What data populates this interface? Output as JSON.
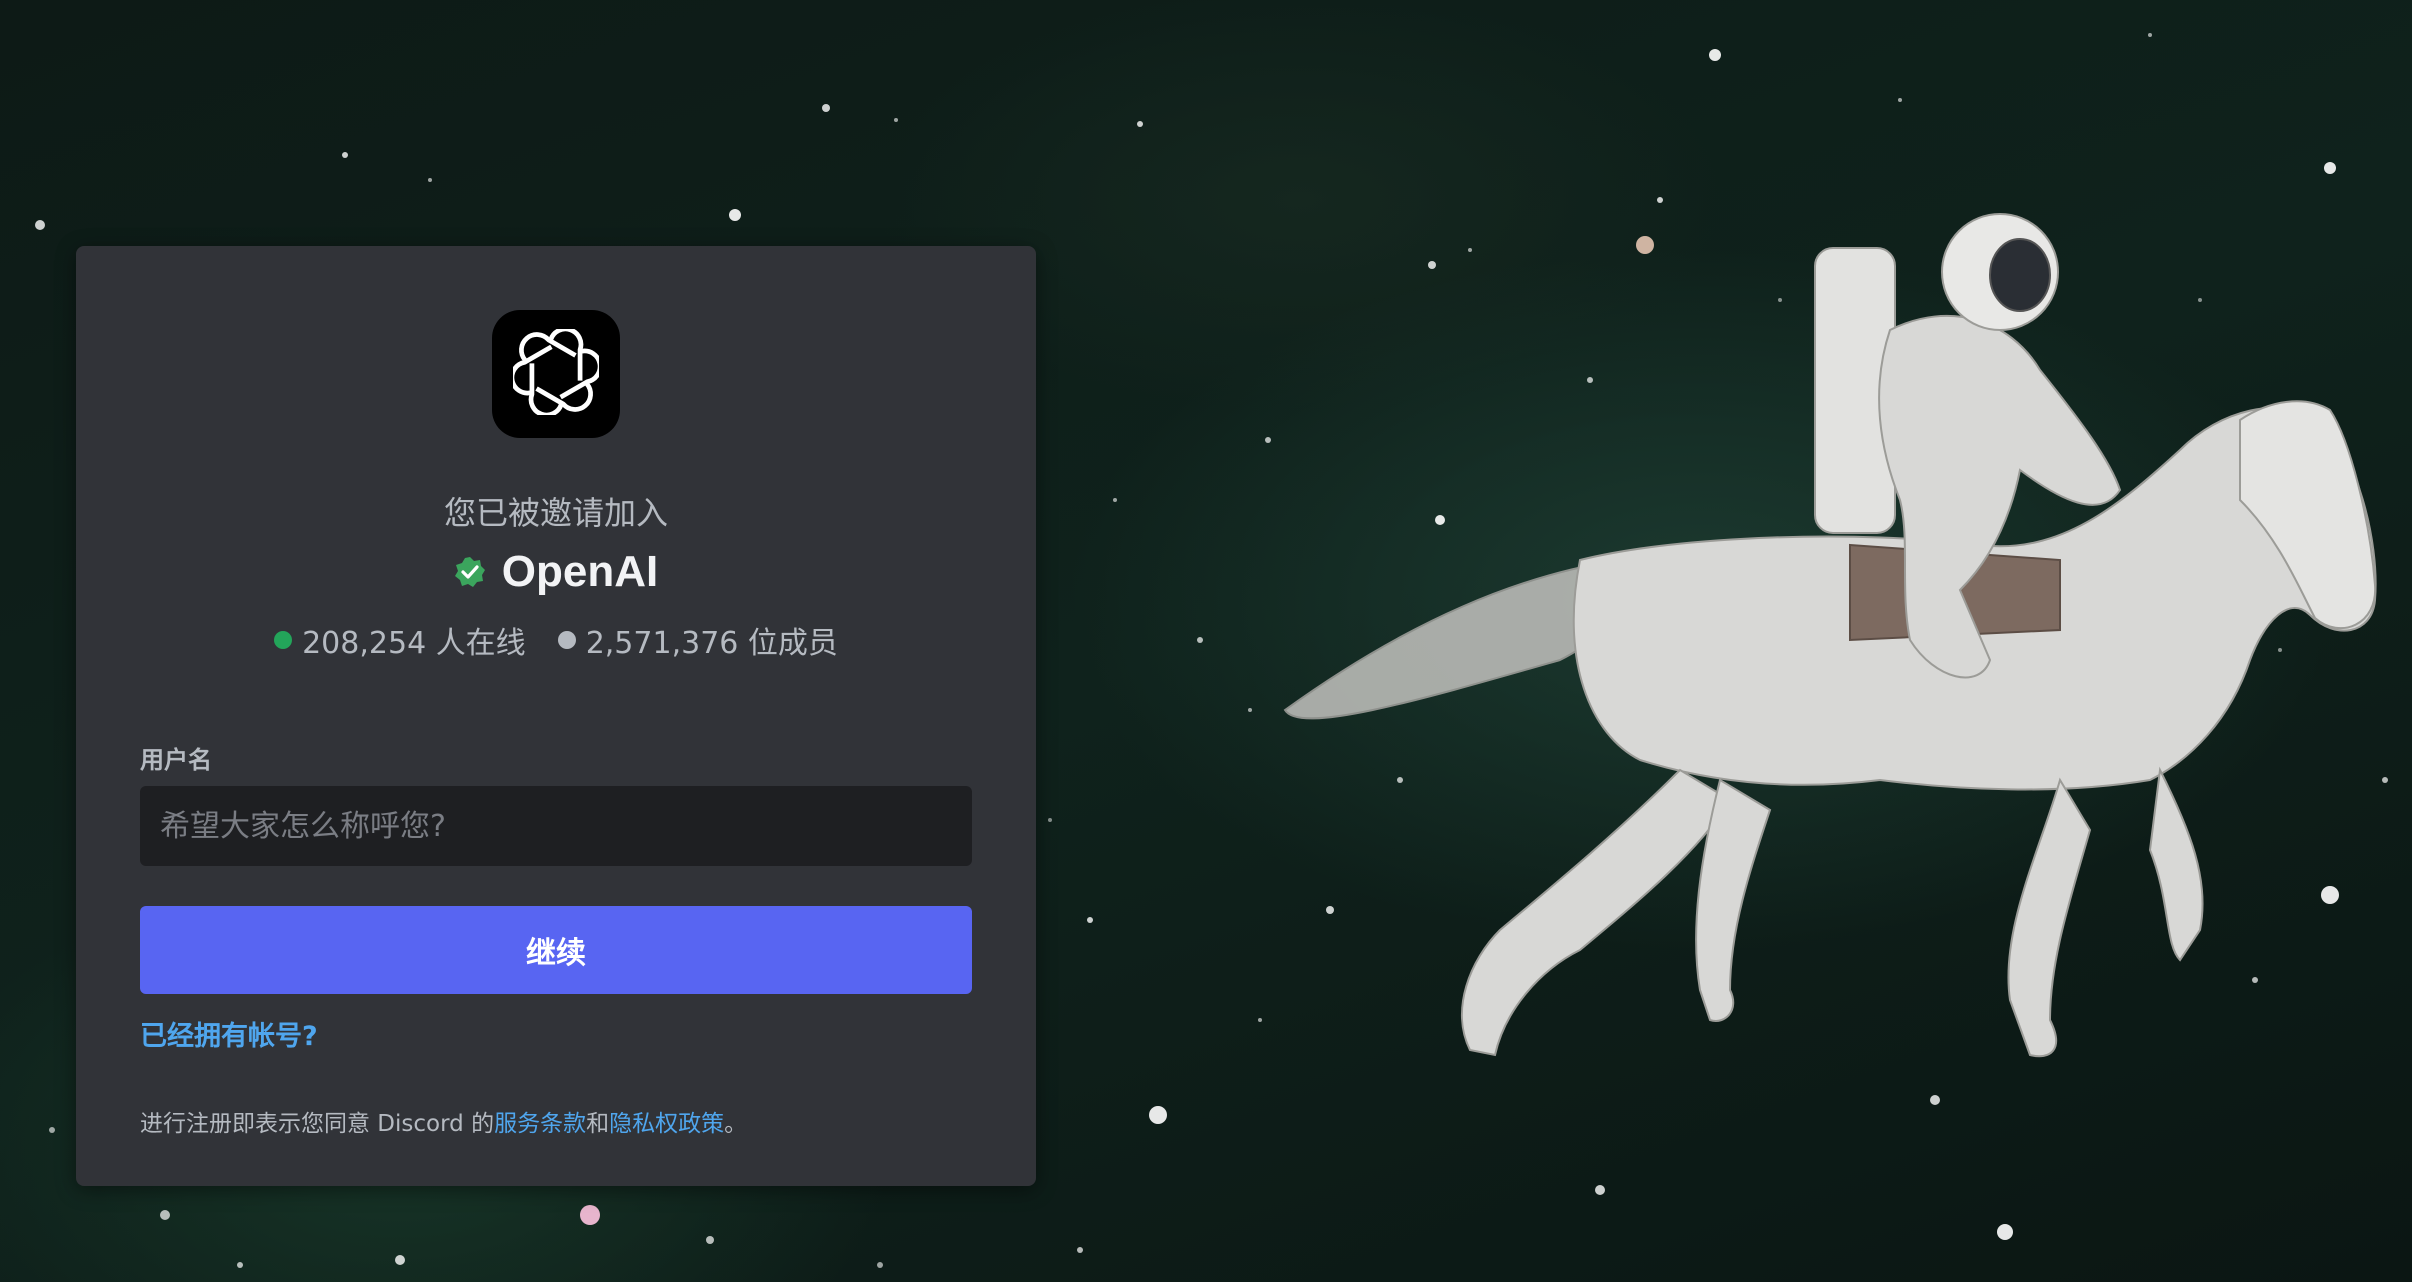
{
  "invite": {
    "heading": "您已被邀请加入",
    "server_name": "OpenAI",
    "online_count": "208,254 人在线",
    "member_count": "2,571,376 位成员",
    "online_color": "#23a55a",
    "member_color": "#b5bac1"
  },
  "form": {
    "username_label": "用户名",
    "username_placeholder": "希望大家怎么称呼您?",
    "username_value": "",
    "continue_label": "继续",
    "have_account_link": "已经拥有帐号?"
  },
  "terms": {
    "prefix": "进行注册即表示您同意 Discord 的",
    "tos_link": "服务条款",
    "conjunction": "和",
    "privacy_link": "隐私权政策",
    "suffix": "。"
  },
  "icons": {
    "logo": "openai-logo-icon",
    "verified": "verified-check-icon"
  },
  "colors": {
    "card_bg": "#313338",
    "button_bg": "#5865f2",
    "link": "#4fa6ee",
    "input_bg": "#1e1f22"
  }
}
